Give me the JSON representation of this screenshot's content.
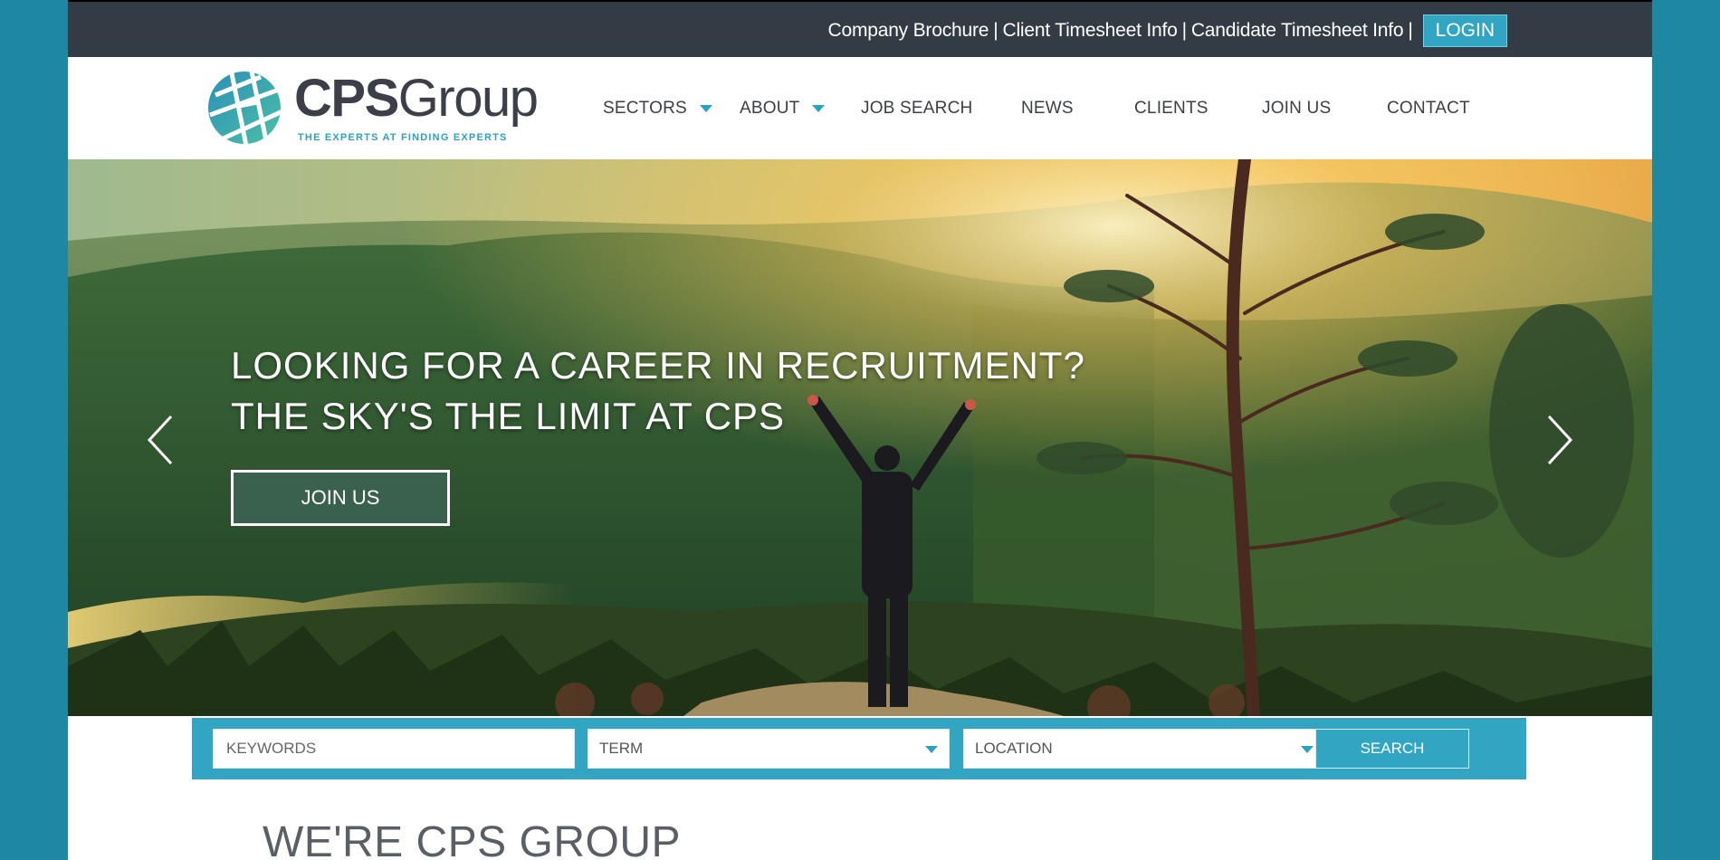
{
  "topbar": {
    "links": [
      "Company Brochure",
      "Client Timesheet Info",
      "Candidate Timesheet Info"
    ],
    "separator": "|",
    "login_label": "LOGIN"
  },
  "logo": {
    "name_bold": "CPS",
    "name_regular": "Group",
    "tagline": "THE EXPERTS AT FINDING EXPERTS"
  },
  "nav": {
    "items": [
      {
        "label": "SECTORS",
        "has_dropdown": true
      },
      {
        "label": "ABOUT",
        "has_dropdown": true
      },
      {
        "label": "JOB SEARCH",
        "has_dropdown": false
      },
      {
        "label": "NEWS",
        "has_dropdown": false
      },
      {
        "label": "CLIENTS",
        "has_dropdown": false
      },
      {
        "label": "JOIN US",
        "has_dropdown": false
      },
      {
        "label": "CONTACT",
        "has_dropdown": false
      }
    ]
  },
  "hero": {
    "line1": "LOOKING FOR A CAREER IN RECRUITMENT?",
    "line2": "THE SKY'S THE LIMIT AT CPS",
    "cta_label": "JOIN US",
    "prev_icon": "chevron-left-icon",
    "next_icon": "chevron-right-icon"
  },
  "search": {
    "keywords_placeholder": "KEYWORDS",
    "term_value": "TERM",
    "location_value": "LOCATION",
    "button_label": "SEARCH"
  },
  "section": {
    "title": "WE'RE CPS GROUP"
  },
  "colors": {
    "accent": "#32a5c3",
    "topbar": "#333c45",
    "page_bg": "#1e88a3",
    "nav_text": "#3c3e48"
  }
}
